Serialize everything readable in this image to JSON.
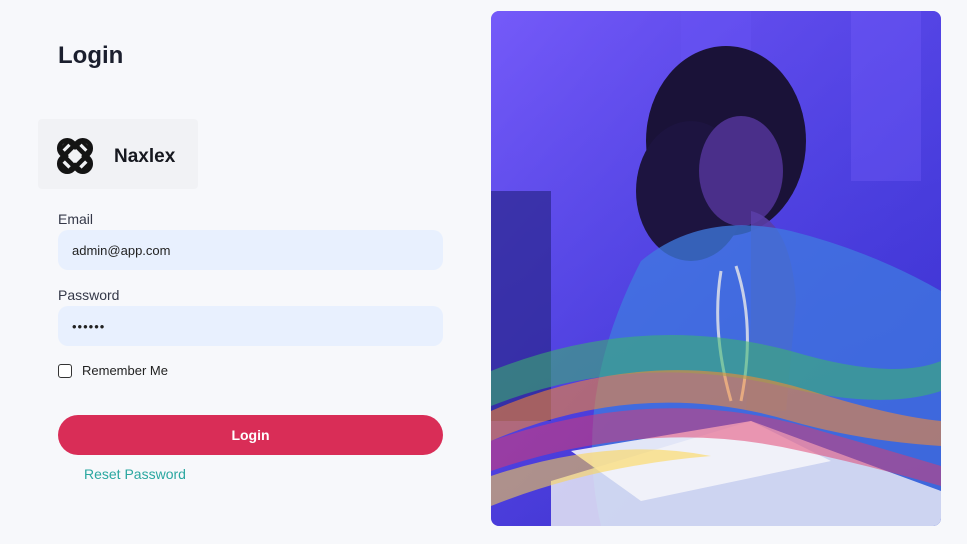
{
  "page": {
    "title": "Login"
  },
  "brand": {
    "name": "Naxlex",
    "logo_icon": "interlocking-cross-icon"
  },
  "form": {
    "email_label": "Email",
    "email_value": "admin@app.com",
    "password_label": "Password",
    "password_value": "••••••",
    "remember_label": "Remember Me",
    "remember_checked": false,
    "login_label": "Login",
    "reset_label": "Reset Password"
  },
  "colors": {
    "accent": "#d92d57",
    "link": "#2aa7a0",
    "input_bg": "#e8f0fe",
    "hero_overlay": "#4a3fe6"
  },
  "hero": {
    "image": "student-nurse-studying-photo"
  }
}
